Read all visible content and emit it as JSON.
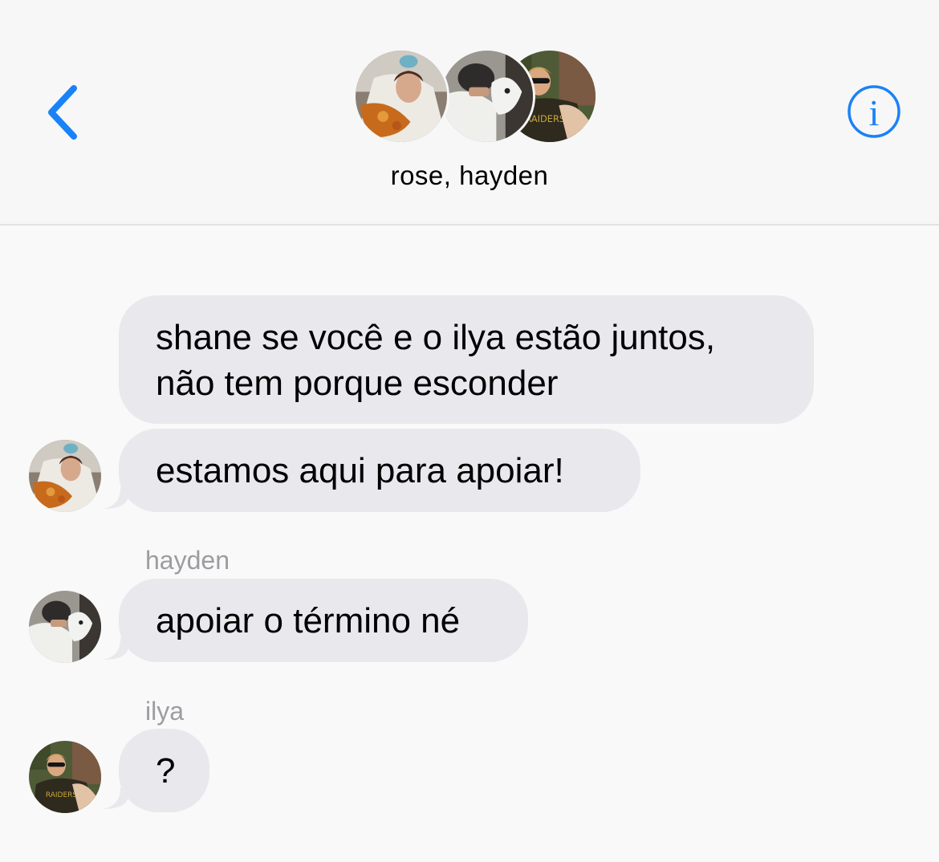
{
  "header": {
    "title": "rose, hayden",
    "back_icon": "chevron-left-icon",
    "info_icon": "info-circle-icon",
    "accent_color": "#1A82F7"
  },
  "messages": [
    {
      "sender": "",
      "avatar": "rose",
      "lines": [
        "shane se você e o ilya estão juntos,",
        "não tem porque esconder"
      ]
    },
    {
      "sender": "",
      "avatar": "rose",
      "lines": [
        "estamos aqui para apoiar!"
      ]
    },
    {
      "sender": "hayden",
      "avatar": "hayden",
      "lines": [
        "apoiar o término né"
      ]
    },
    {
      "sender": "ilya",
      "avatar": "ilya",
      "lines": [
        "?"
      ]
    }
  ],
  "colors": {
    "bubble_incoming": "#E9E8ED",
    "background": "#F9F9F9",
    "sender_label": "#9C9CA1"
  }
}
